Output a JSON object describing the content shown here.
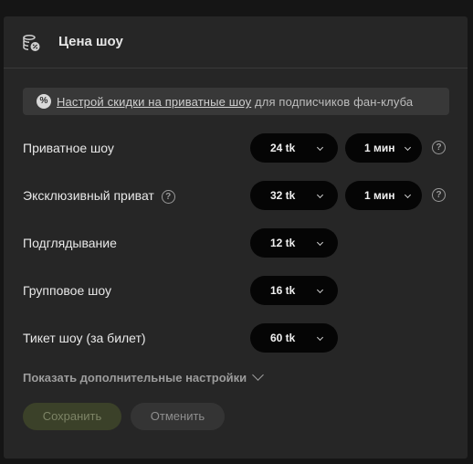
{
  "header": {
    "title": "Цена шоу",
    "icon": "coins-discount-icon"
  },
  "banner": {
    "badge": "%",
    "link": "Настрой скидки на приватные шоу",
    "rest": " для подписчиков фан-клуба"
  },
  "rows": [
    {
      "label": "Приватное шоу",
      "price": "24 tk",
      "time": "1 мин",
      "help_after_time": true
    },
    {
      "label": "Эксклюзивный приват",
      "price": "32 tk",
      "time": "1 мин",
      "help_inline": true,
      "help_after_time": true
    },
    {
      "label": "Подглядывание",
      "price": "12 tk"
    },
    {
      "label": "Групповое шоу",
      "price": "16 tk"
    },
    {
      "label": "Тикет шоу (за билет)",
      "price": "60 tk"
    }
  ],
  "help_glyph": "?",
  "more_settings": "Показать дополнительные настройки",
  "buttons": {
    "save": "Сохранить",
    "cancel": "Отменить"
  },
  "colors": {
    "panel_bg": "#262626",
    "select_bg": "#050505",
    "save_bg": "#3b4129"
  }
}
